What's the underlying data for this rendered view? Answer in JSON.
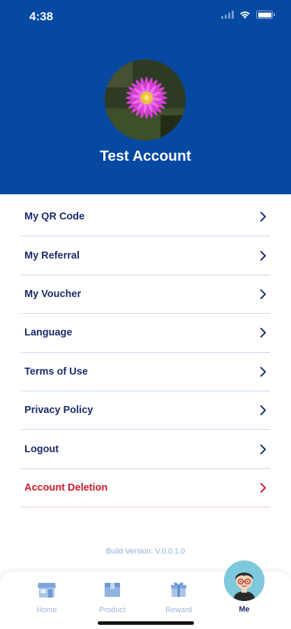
{
  "status_bar": {
    "time": "4:38"
  },
  "profile": {
    "name": "Test Account"
  },
  "menu": {
    "items": [
      {
        "label": "My QR Code"
      },
      {
        "label": "My Referral"
      },
      {
        "label": "My Voucher"
      },
      {
        "label": "Language"
      },
      {
        "label": "Terms of Use"
      },
      {
        "label": "Privacy Policy"
      },
      {
        "label": "Logout"
      },
      {
        "label": "Account Deletion"
      }
    ]
  },
  "build_version": "Build Version: V.0.0.1.0",
  "tabbar": {
    "tabs": [
      {
        "label": "Home",
        "icon": "store-icon"
      },
      {
        "label": "Product",
        "icon": "box-icon"
      },
      {
        "label": "Reward",
        "icon": "gift-icon"
      },
      {
        "label": "Me",
        "icon": "avatar-icon",
        "active": true
      }
    ]
  },
  "colors": {
    "header_bg": "#0549a3",
    "menu_text": "#1b2c6b",
    "danger": "#d0182a",
    "tab_inactive": "#9cb6d8",
    "me_circle": "#7ec9dc"
  }
}
